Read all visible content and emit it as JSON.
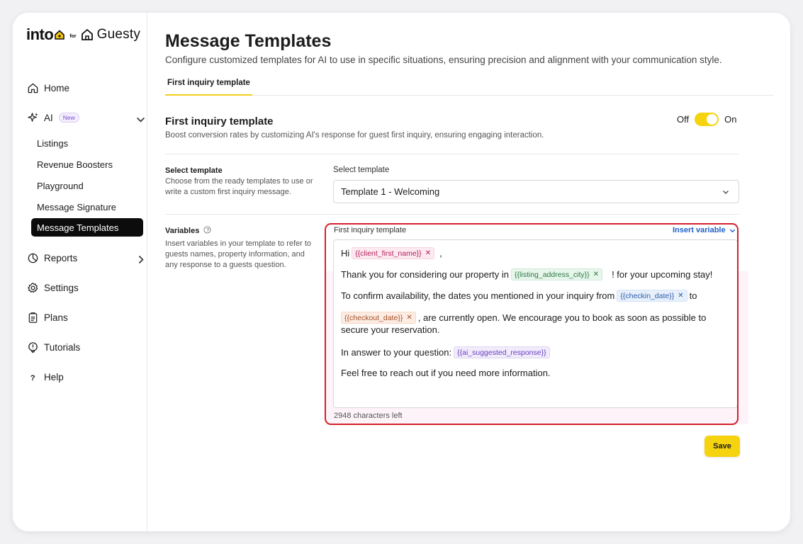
{
  "logo": {
    "brand": "into",
    "for_text": "for",
    "partner": "Guesty"
  },
  "sidebar": {
    "items": [
      {
        "label": "Home",
        "icon": "home-icon"
      },
      {
        "label": "AI",
        "icon": "sparkle-icon",
        "badge": "New"
      },
      {
        "label": "Reports",
        "icon": "pie-chart-icon"
      },
      {
        "label": "Settings",
        "icon": "gear-icon"
      },
      {
        "label": "Plans",
        "icon": "clipboard-icon"
      },
      {
        "label": "Tutorials",
        "icon": "lightbulb-icon"
      },
      {
        "label": "Help",
        "icon": "question-icon"
      }
    ],
    "ai_subitems": [
      "Listings",
      "Revenue Boosters",
      "Playground",
      "Message Signature",
      "Message Templates"
    ],
    "active_subitem": "Message Templates"
  },
  "header": {
    "title": "Message Templates",
    "subtitle": "Configure customized templates for AI to use in specific situations, ensuring precision and alignment with your communication style."
  },
  "tabs": [
    {
      "label": "First inquiry template",
      "active": true
    }
  ],
  "section": {
    "title": "First inquiry template",
    "description": "Boost conversion rates by customizing AI's response for guest first inquiry, ensuring engaging interaction.",
    "toggle": {
      "off_label": "Off",
      "on_label": "On",
      "state": "on"
    }
  },
  "select_template": {
    "label": "Select template",
    "help": "Choose from the ready templates to use or write a custom first inquiry message.",
    "field_label": "Select template",
    "value": "Template 1 - Welcoming"
  },
  "variables": {
    "label": "Variables",
    "help": "Insert variables in your template to refer to guests names, property information, and any response to a guests question."
  },
  "editor": {
    "label": "First inquiry template",
    "insert_variable": "Insert variable",
    "greeting": "Hi",
    "greeting_after": ",",
    "line2_before": "Thank you for considering our property in",
    "line2_after": "! for your upcoming stay!",
    "line3_before": "To confirm availability, the dates you mentioned in your inquiry from",
    "line3_after": "to",
    "line4_after": ", are currently open. We encourage you to book as soon as possible to",
    "line5": "secure your reservation.",
    "line6_before": "In answer to your question:",
    "line7": "Feel free to reach out if you need more information.",
    "chips": {
      "client": "{{client_first_name}}",
      "city": "{{listing_address_city}}",
      "checkin": "{{checkin_date}}",
      "checkout": "{{checkout_date}}",
      "ai": "{{ai_suggested_response}}"
    },
    "chars_left": "2948 characters left"
  },
  "actions": {
    "save": "Save"
  },
  "colors": {
    "accent": "#f5d30f",
    "active_nav": "#0c0c0c",
    "highlight_border": "#d4212b",
    "link": "#1f5fc9"
  }
}
